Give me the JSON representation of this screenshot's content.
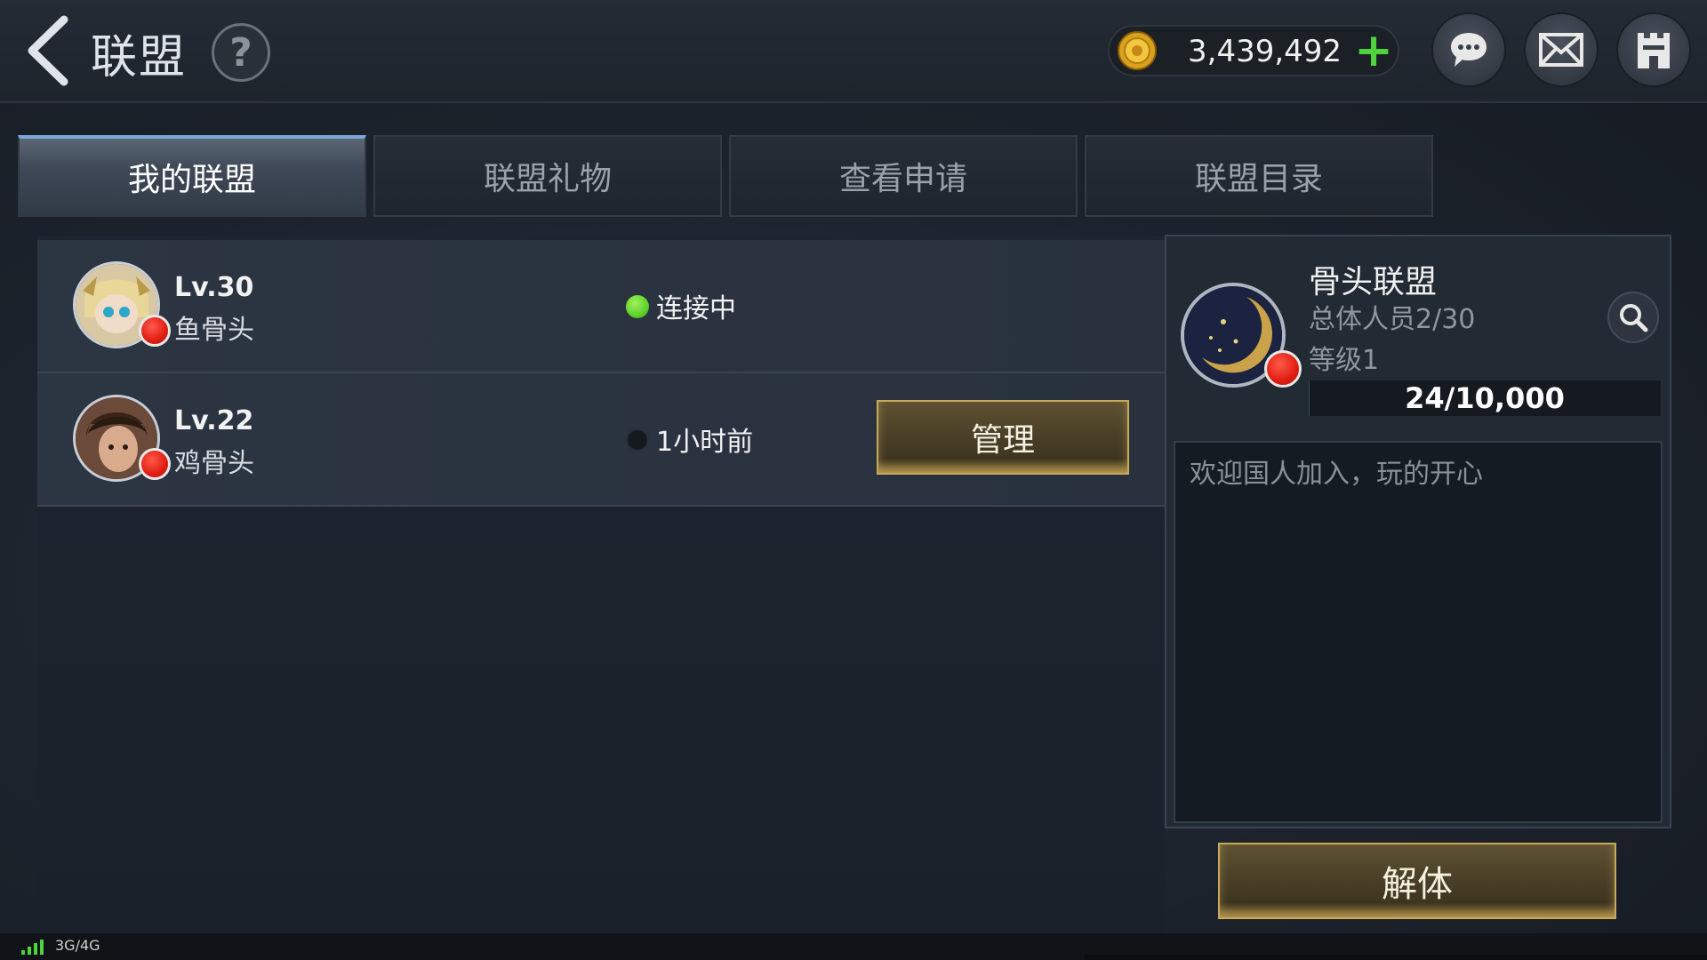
{
  "header": {
    "title": "联盟",
    "help_label": "?",
    "currency_value": "3,439,492",
    "add_label": "+"
  },
  "tabs": [
    {
      "label": "我的联盟",
      "active": true
    },
    {
      "label": "联盟礼物",
      "active": false
    },
    {
      "label": "查看申请",
      "active": false
    },
    {
      "label": "联盟目录",
      "active": false
    }
  ],
  "members": [
    {
      "level": "Lv.30",
      "name": "鱼骨头",
      "status": "连接中",
      "status_color": "#5fd22a",
      "online": true
    },
    {
      "level": "Lv.22",
      "name": "鸡骨头",
      "status": "1小时前",
      "status_color": "#1a1f26",
      "online": false,
      "action_label": "管理"
    }
  ],
  "alliance": {
    "name": "骨头联盟",
    "members": "总体人员2/30",
    "level": "等级1",
    "progress_text": "24/10,000",
    "progress_fraction": 0.0024,
    "notice": "欢迎国人加入，玩的开心"
  },
  "disband_label": "解体",
  "status_bar": {
    "network": "3G/4G"
  },
  "colors": {
    "accent_blue": "#7aa8d8",
    "gold_border": "#c7a95a",
    "online_green": "#5fd22a",
    "plus_green": "#4fd33c",
    "flag_red": "#e01e12"
  },
  "icons": [
    "back-arrow-icon",
    "help-icon",
    "coin-icon",
    "add-icon",
    "chat-icon",
    "mail-icon",
    "castle-icon",
    "search-icon",
    "china-flag-icon",
    "alliance-emblem-icon",
    "signal-icon"
  ]
}
